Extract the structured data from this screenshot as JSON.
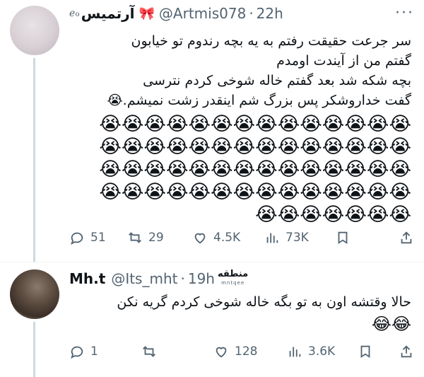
{
  "tweet1": {
    "display_name": "آرتمیس",
    "name_suffix": "ℯℴ",
    "badge_emoji": "🎀",
    "handle": "@Artmis078",
    "dot": "·",
    "time": "22h",
    "more": "···",
    "text_lines": [
      "سر جرعت حقیقت رفتم به یه بچه رندوم تو خیابون",
      "گفتم من از آیندت اومدم",
      "بچه شکه شد بعد گفتم خاله شوخی کردم نترسی",
      "گفت خداروشکر پس بزرگ شم اینقدر زشت نمیشم.😭"
    ],
    "emoji_rows": [
      "😭😭😭😭😭😭😭😭😭😭😭😭😭😭",
      "😭😭😭😭😭😭😭😭😭😭😭😭😭😭",
      "😭😭😭😭😭😭😭😭😭😭😭😭😭😭",
      "😭😭😭😭😭😭😭😭😭😭😭😭😭😭",
      "😭😭😭😭😭😭😭"
    ],
    "replies": "51",
    "retweets": "29",
    "likes": "4.5K",
    "views": "73K"
  },
  "tweet2": {
    "display_name": "Mh.t",
    "handle": "@Its_mht",
    "dot": "·",
    "time": "19h",
    "watermark_logo": "منطقه",
    "watermark_sub": "mntqee",
    "text": "حالا وقتشه اون به تو بگه خاله شوخی کردم گریه نکن",
    "emojis": "😂😂",
    "replies": "1",
    "retweets": "",
    "likes": "128",
    "views": "3.6K"
  },
  "icons": [
    "reply-icon",
    "retweet-icon",
    "like-icon",
    "views-icon",
    "bookmark-icon",
    "share-icon"
  ]
}
